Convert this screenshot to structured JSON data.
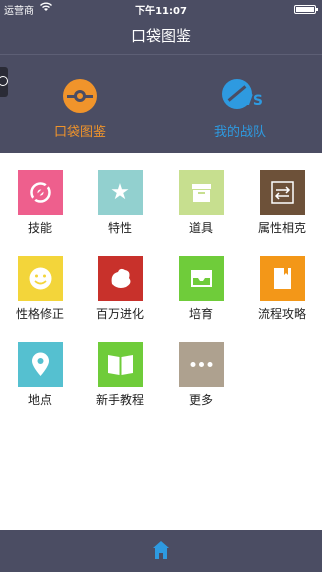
{
  "status_bar": {
    "carrier": "运营商",
    "wifi": "wifi-icon",
    "time": "下午11:07",
    "battery": "battery-icon"
  },
  "nav": {
    "title": "口袋图鉴"
  },
  "hero": {
    "side_tab_icon": "power-icon",
    "left": {
      "label": "口袋图鉴",
      "icon": "pokeball-icon",
      "color": "#f0942b"
    },
    "right": {
      "label": "我的战队",
      "icon": "versus-icon",
      "color": "#2e9ae0"
    }
  },
  "grid": {
    "items": [
      {
        "label": "技能",
        "icon": "skill-icon",
        "color": "#ee5f8d"
      },
      {
        "label": "特性",
        "icon": "star-icon",
        "color": "#92d0cf"
      },
      {
        "label": "道具",
        "icon": "box-icon",
        "color": "#c7df8f"
      },
      {
        "label": "属性相克",
        "icon": "swap-icon",
        "color": "#6d5139"
      },
      {
        "label": "性格修正",
        "icon": "smile-icon",
        "color": "#f3d53a"
      },
      {
        "label": "百万进化",
        "icon": "dumpling-icon",
        "color": "#c8312b"
      },
      {
        "label": "培育",
        "icon": "tray-icon",
        "color": "#6fcc3a"
      },
      {
        "label": "流程攻略",
        "icon": "book-icon",
        "color": "#f39718"
      },
      {
        "label": "地点",
        "icon": "location-icon",
        "color": "#55c0d0"
      },
      {
        "label": "新手教程",
        "icon": "open-book-icon",
        "color": "#6fcc3a"
      },
      {
        "label": "更多",
        "icon": "more-icon",
        "color": "#aea18f"
      }
    ]
  },
  "bottom_bar": {
    "home_icon": "home-icon",
    "home_color": "#2e9ae0"
  }
}
